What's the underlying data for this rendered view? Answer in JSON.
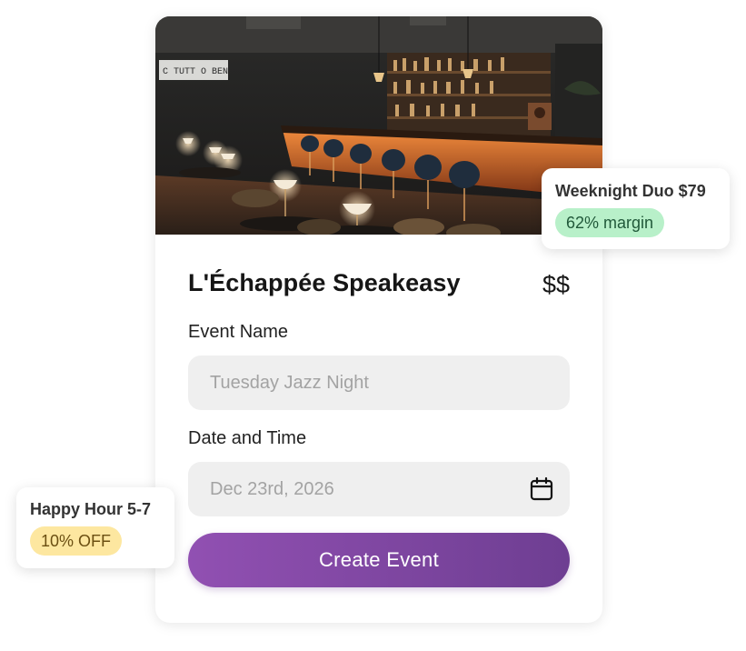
{
  "venue": {
    "name": "L'Échappée Speakeasy",
    "price_level": "$$"
  },
  "form": {
    "event_name_label": "Event Name",
    "event_name_placeholder": "Tuesday Jazz Night",
    "date_label": "Date and Time",
    "date_placeholder": "Dec 23rd, 2026",
    "date_icon": "calendar-icon",
    "submit_label": "Create Event"
  },
  "hero": {
    "sign_text": "C TUTT O BEN"
  },
  "promos": [
    {
      "title": "Weeknight Duo $79",
      "badge": "62% margin",
      "badge_color": "#b8f0c9"
    },
    {
      "title": "Happy Hour 5-7",
      "badge": "10% OFF",
      "badge_color": "#fde7a0"
    }
  ],
  "colors": {
    "accent_start": "#9150b2",
    "accent_end": "#6e3e92"
  }
}
